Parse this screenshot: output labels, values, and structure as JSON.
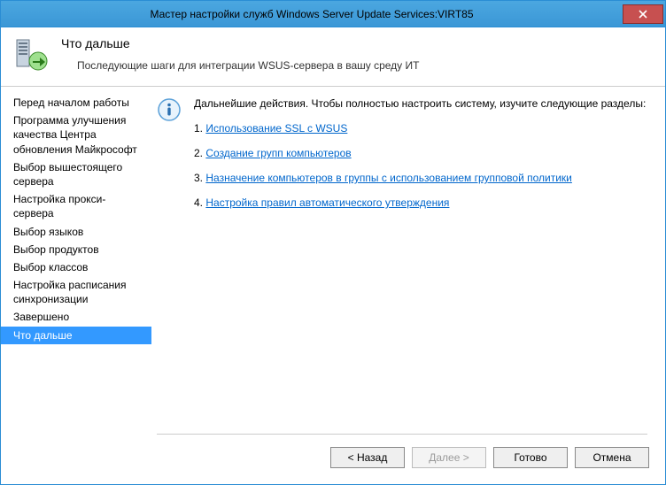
{
  "titlebar": {
    "title": "Мастер настройки служб Windows Server Update Services:VIRT85"
  },
  "header": {
    "title": "Что дальше",
    "subtitle": "Последующие шаги для интеграции WSUS-сервера в вашу среду ИТ"
  },
  "sidebar": {
    "items": [
      {
        "label": "Перед началом работы"
      },
      {
        "label": "Программа улучшения качества Центра обновления Майкрософт"
      },
      {
        "label": "Выбор вышестоящего сервера"
      },
      {
        "label": "Настройка прокси-сервера"
      },
      {
        "label": "Выбор языков"
      },
      {
        "label": "Выбор продуктов"
      },
      {
        "label": "Выбор классов"
      },
      {
        "label": "Настройка расписания синхронизации"
      },
      {
        "label": "Завершено"
      },
      {
        "label": "Что дальше"
      }
    ],
    "selected_index": 9
  },
  "main": {
    "intro": "Дальнейшие действия. Чтобы полностью настроить систему, изучите следующие разделы:",
    "links": [
      {
        "num": "1.",
        "text": "Использование SSL с WSUS"
      },
      {
        "num": "2.",
        "text": "Создание групп компьютеров"
      },
      {
        "num": "3.",
        "text": "Назначение компьютеров в группы с использованием групповой политики"
      },
      {
        "num": "4.",
        "text": "Настройка правил автоматического утверждения"
      }
    ]
  },
  "buttons": {
    "back": "< Назад",
    "next": "Далее >",
    "finish": "Готово",
    "cancel": "Отмена"
  }
}
